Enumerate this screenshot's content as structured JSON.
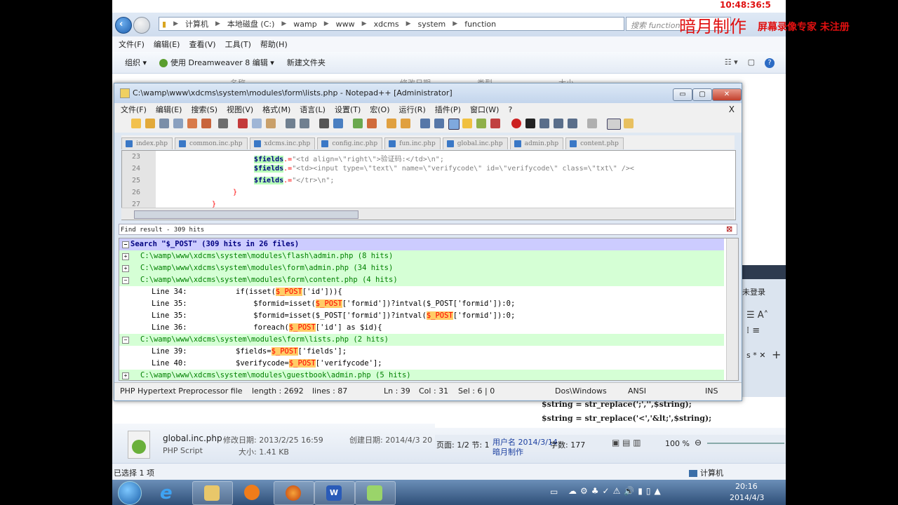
{
  "overlay": {
    "clock": "10:48:36:5",
    "watermark_title": "暗月制作",
    "recorder_text": "屏幕录像专家 未注册"
  },
  "explorer": {
    "breadcrumbs": [
      "计算机",
      "本地磁盘 (C:)",
      "wamp",
      "www",
      "xdcms",
      "system",
      "function"
    ],
    "search_placeholder": "搜索 function",
    "menu": [
      "文件(F)",
      "编辑(E)",
      "查看(V)",
      "工具(T)",
      "帮助(H)"
    ],
    "toolbar": {
      "organize": "组织",
      "open_with": "使用 Dreamweaver 8 编辑",
      "new_folder": "新建文件夹"
    },
    "column_headers": [
      "名称",
      "修改日期",
      "类型",
      "大小"
    ],
    "details": {
      "filename": "global.inc.php",
      "modified": "修改日期: 2013/2/25 16:59",
      "created": "创建日期: 2014/4/3 20",
      "type": "PHP Script",
      "size": "大小: 1.41 KB"
    },
    "status": {
      "selected": "已选择 1 项",
      "computer": "计算机"
    }
  },
  "word": {
    "partial_login": "未登录",
    "partial_tab": "s * ✕",
    "lines": [
      "$string = str_replace(';','',$string);",
      "$string = str_replace('<','&lt;',$string);"
    ],
    "status": {
      "page": "页面: 1/2 节: 1",
      "user": "用户名 2014/3/14",
      "author": "暗月制作",
      "wordcount": "字数: 177",
      "zoom": "100 %"
    }
  },
  "notepad": {
    "title": "C:\\wamp\\www\\xdcms\\system\\modules\\form\\lists.php - Notepad++ [Administrator]",
    "menu": [
      "文件(F)",
      "编辑(E)",
      "搜索(S)",
      "视图(V)",
      "格式(M)",
      "语言(L)",
      "设置(T)",
      "宏(O)",
      "运行(R)",
      "插件(P)",
      "窗口(W)",
      "?"
    ],
    "close_doc": "X",
    "tabs": [
      "index.php",
      "common.inc.php",
      "xdcms.inc.php",
      "config.inc.php",
      "fun.inc.php",
      "global.inc.php",
      "admin.php",
      "content.php"
    ],
    "editor": {
      "line_numbers": [
        "23",
        "24",
        "25",
        "26",
        "27"
      ],
      "lines": [
        {
          "var": "$fields",
          "op": ".=",
          "str": "\"<td align=\\\"right\\\">验证码:</td>\\n\";"
        },
        {
          "var": "$fields",
          "op": ".=",
          "str": "\"<td><input type=\\\"text\\\" name=\\\"verifycode\\\" id=\\\"verifycode\\\" class=\\\"txt\\\" /><"
        },
        {
          "var": "$fields",
          "op": ".=",
          "str": "\"</tr>\\n\";"
        },
        {
          "var": "",
          "op": "",
          "str": "}"
        },
        {
          "var": "",
          "op": "",
          "str": "}"
        }
      ]
    },
    "find_header": "Find result - 309 hits",
    "results": [
      {
        "kind": "head",
        "text": "Search \"$_POST\" (309 hits in 26 files)"
      },
      {
        "kind": "file",
        "text": "C:\\wamp\\www\\xdcms\\system\\modules\\flash\\admin.php (8 hits)"
      },
      {
        "kind": "file",
        "text": "C:\\wamp\\www\\xdcms\\system\\modules\\form\\admin.php (34 hits)"
      },
      {
        "kind": "file",
        "text": "C:\\wamp\\www\\xdcms\\system\\modules\\form\\content.php (4 hits)"
      },
      {
        "kind": "line",
        "num": "Line 34:",
        "pre": "if(isset(",
        "hit": "$_POST",
        "post": "['id'])){"
      },
      {
        "kind": "line",
        "num": "Line 35:",
        "pre": "    $formid=isset(",
        "hit": "$_POST",
        "post": "['formid'])?intval($_POST['formid']):0;"
      },
      {
        "kind": "line",
        "num": "Line 35:",
        "pre": "    $formid=isset($_POST['formid'])?intval(",
        "hit": "$_POST",
        "post": "['formid']):0;"
      },
      {
        "kind": "line",
        "num": "Line 36:",
        "pre": "    foreach(",
        "hit": "$_POST",
        "post": "['id'] as $id){"
      },
      {
        "kind": "file",
        "text": "C:\\wamp\\www\\xdcms\\system\\modules\\form\\lists.php (2 hits)"
      },
      {
        "kind": "line",
        "num": "Line 39:",
        "pre": "$fields=",
        "hit": "$_POST",
        "post": "['fields'];"
      },
      {
        "kind": "line",
        "num": "Line 40:",
        "pre": "$verifycode=",
        "hit": "$_POST",
        "post": "['verifycode'];"
      },
      {
        "kind": "file",
        "text": "C:\\wamp\\www\\xdcms\\system\\modules\\guestbook\\admin.php (5 hits)"
      }
    ],
    "status": {
      "lang": "PHP Hypertext Preprocessor file",
      "length": "length : 2692",
      "lines": "lines : 87",
      "ln": "Ln : 39",
      "col": "Col : 31",
      "sel": "Sel : 6 | 0",
      "eol": "Dos\\Windows",
      "enc": "ANSI",
      "mode": "INS"
    }
  },
  "taskbar": {
    "time": "20:16",
    "date": "2014/4/3"
  }
}
